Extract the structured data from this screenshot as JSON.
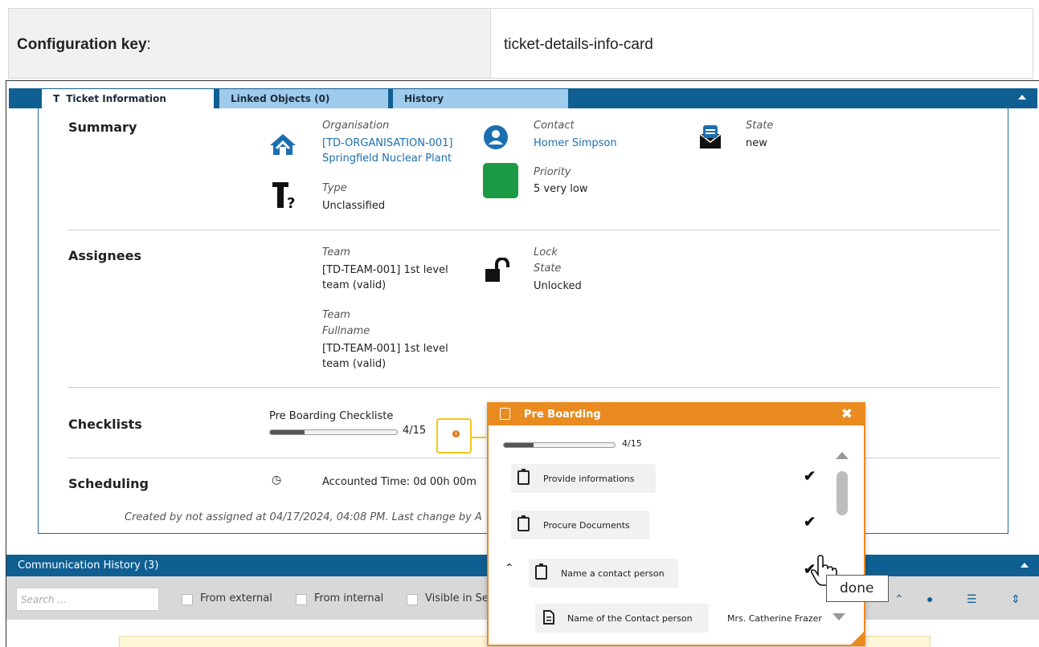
{
  "config": {
    "key_label": "Configuration key",
    "key_colon": ":",
    "key_value": "ticket-details-info-card"
  },
  "tabs": [
    {
      "label": "Ticket Information",
      "icon": "T"
    },
    {
      "label": "Linked Objects (0)"
    },
    {
      "label": "History"
    }
  ],
  "summary": {
    "title": "Summary",
    "organisation_label": "Organisation",
    "organisation_value_1": "[TD-ORGANISATION-001]",
    "organisation_value_2": "Springfield Nuclear Plant",
    "contact_label": "Contact",
    "contact_value": "Homer Simpson",
    "state_label": "State",
    "state_value": "new",
    "priority_label": "Priority",
    "priority_value": "5 very low",
    "priority_color": "#1a9b43",
    "type_label": "Type",
    "type_value": "Unclassified"
  },
  "assignees": {
    "title": "Assignees",
    "team_label": "Team",
    "team_value_1": "[TD-TEAM-001] 1st level",
    "team_value_2": "team (valid)",
    "lock_label_1": "Lock",
    "lock_label_2": "State",
    "lock_value": "Unlocked",
    "team_fullname_label_1": "Team",
    "team_fullname_label_2": "Fullname",
    "team_fullname_value_1": "[TD-TEAM-001] 1st level",
    "team_fullname_value_2": "team (valid)"
  },
  "checklists": {
    "title": "Checklists",
    "name": "Pre Boarding Checkliste",
    "progress_text": "4/15",
    "progress_fraction": 0.27
  },
  "scheduling": {
    "title": "Scheduling",
    "accounted_time": "Accounted Time: 0d 00h 00m"
  },
  "footer_text": "Created by not assigned at 04/17/2024, 04:08 PM. Last change by A",
  "communication": {
    "title": "Communication History (3)",
    "search_placeholder": "Search ...",
    "filter_external": "From external",
    "filter_internal": "From internal",
    "filter_visible": "Visible in Se"
  },
  "popup": {
    "title": "Pre Boarding",
    "close": "✖",
    "progress_text": "4/15",
    "progress_fraction": 0.27,
    "items": [
      {
        "label": "Provide informations",
        "check": "✔"
      },
      {
        "label": "Procure Documents",
        "check": "✔"
      },
      {
        "label": "Name a contact person",
        "check": "✔"
      }
    ],
    "sub_item_label": "Name of the Contact person",
    "sub_item_value": "Mrs. Catherine Frazer",
    "tooltip": "done"
  },
  "colors": {
    "accent": "#0f5f93",
    "popup_accent": "#e98b20",
    "highlight": "#f5c518"
  }
}
